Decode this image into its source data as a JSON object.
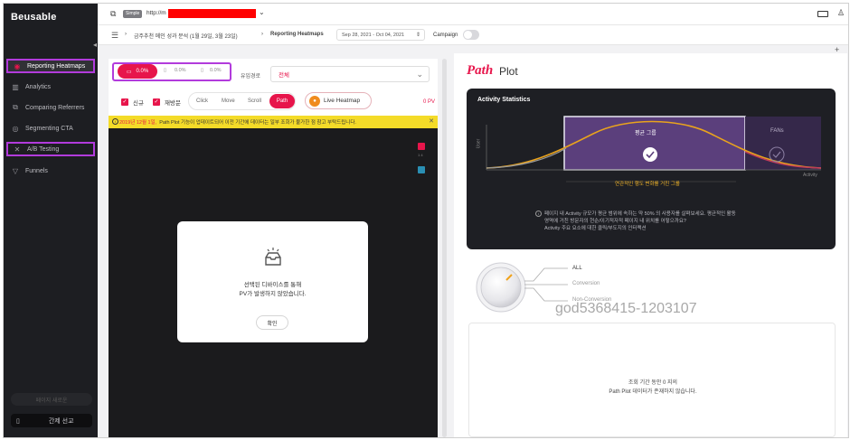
{
  "app": {
    "logo": "Beusable"
  },
  "sidebar": {
    "items": [
      {
        "label": "Reporting Heatmaps",
        "icon": "heatmap-icon",
        "glyph": "◉"
      },
      {
        "label": "Analytics",
        "icon": "bar-chart-icon",
        "glyph": "▥"
      },
      {
        "label": "Comparing Referrers",
        "icon": "compare-icon",
        "glyph": "⧉"
      },
      {
        "label": "Segmenting CTA",
        "icon": "target-icon",
        "glyph": "◎"
      },
      {
        "label": "A/B Testing",
        "icon": "split-icon",
        "glyph": "✕"
      },
      {
        "label": "Funnels",
        "icon": "funnel-icon",
        "glyph": "▽"
      }
    ],
    "bottom1": "페이지 새로운",
    "bottom2": "간제 선교"
  },
  "topbar": {
    "simple_badge": "Simple",
    "url_prefix": "http://m"
  },
  "breadcrumb": {
    "item1": "금주추천 메인 성과 분석 (1월 29일, 3월 23일)",
    "item2": "Reporting Heatmaps",
    "date_range": "Sep 28, 2021 - Oct 04, 2021",
    "campaign_label": "Campaign"
  },
  "heatmap_panel": {
    "stats": [
      "0.0%",
      "0.0%",
      "0.0%"
    ],
    "inflow_label": "유입경로",
    "inflow_value": "전체",
    "checkboxes": [
      "신규",
      "재방문"
    ],
    "modes": [
      "Click",
      "Move",
      "Scroll",
      "Path"
    ],
    "active_mode": "Path",
    "live_heatmap": "Live Heatmap",
    "pv": "0 PV",
    "notice_date": "2019년 12월 1일,",
    "notice_text": "Path Plot 기능이 업데이트되어 이전 기간에 데이터는 일부 조회가 불가한 점 참고 부탁드립니다.",
    "modal_line1": "선택된 디바이스를 통해",
    "modal_line2": "PV가 발생하지 않았습니다.",
    "modal_button": "확인"
  },
  "path_plot": {
    "title_script": "Path",
    "title_plain": "Plot",
    "card_title": "Activity Statistics",
    "y_axis": "User",
    "x_axis": "Activity",
    "avg_group": "평균 그룹",
    "fans": "FANs",
    "caption": "연관적인 행도 변화를 거친 그룹",
    "desc_line1": "페이지 내 Activity 규모가 평균 범위에 속하는 약 50% 의 사용자를 살펴보세요. 평균적인 활동",
    "desc_line2": "영역에 거친 방문자의 현순/이기적자적 페이지 내 위치를 어떻으까요?",
    "desc_line3": "Activity 주요 요소에 대한 클릭/부도지의 인터랙션",
    "knob_labels": [
      "ALL",
      "Conversion",
      "Non-Conversion"
    ],
    "watermark": "god5368415-1203107",
    "nodata_line1": "조회 기간 동안 0 지의",
    "nodata_line2": "Path Plot 데이터가 존재하지 않습니다."
  },
  "colors": {
    "accent": "#e7154b",
    "highlight": "#b23bdc",
    "sidebar": "#1d1e22",
    "notice": "#f4db28"
  }
}
